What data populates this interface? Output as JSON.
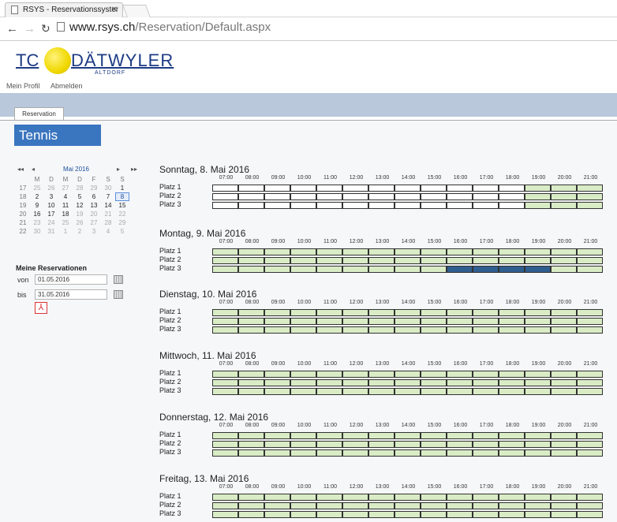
{
  "browser": {
    "tab_title": "RSYS - Reservationssyster",
    "url_host": "www.rsys.ch",
    "url_path": "/Reservation/Default.aspx"
  },
  "logo": {
    "tc": "TC",
    "name": "DÄTWYLER",
    "sub": "ALTDORF"
  },
  "menu": {
    "profile": "Mein Profil",
    "logout": "Abmelden"
  },
  "tab": "Reservation",
  "section_title": "Tennis",
  "calendar": {
    "month": "Mai 2016",
    "nav": {
      "first": "◂◂",
      "prev": "◂",
      "next": "▸",
      "last": "▸▸"
    },
    "weekdays": [
      "M",
      "D",
      "M",
      "D",
      "F",
      "S",
      "S"
    ],
    "weeks": [
      {
        "wk": "17",
        "days": [
          "25",
          "26",
          "27",
          "28",
          "29",
          "30",
          "1"
        ]
      },
      {
        "wk": "18",
        "days": [
          "2",
          "3",
          "4",
          "5",
          "6",
          "7",
          "8"
        ]
      },
      {
        "wk": "19",
        "days": [
          "9",
          "10",
          "11",
          "12",
          "13",
          "14",
          "15"
        ]
      },
      {
        "wk": "20",
        "days": [
          "16",
          "17",
          "18",
          "19",
          "20",
          "21",
          "22"
        ]
      },
      {
        "wk": "21",
        "days": [
          "23",
          "24",
          "25",
          "26",
          "27",
          "28",
          "29"
        ]
      },
      {
        "wk": "22",
        "days": [
          "30",
          "31",
          "1",
          "2",
          "3",
          "4",
          "5"
        ]
      }
    ]
  },
  "my_reservations": {
    "title": "Meine Reservationen",
    "from_label": "von",
    "from_value": "01.05.2016",
    "to_label": "bis",
    "to_value": "31.05.2016",
    "pdf_icon": "pdf-icon"
  },
  "times": [
    "07:00",
    "08:00",
    "09:00",
    "10:00",
    "11:00",
    "12:00",
    "13:00",
    "14:00",
    "15:00",
    "16:00",
    "17:00",
    "18:00",
    "19:00",
    "20:00",
    "21:00"
  ],
  "courts": [
    "Platz 1",
    "Platz 2",
    "Platz 3"
  ],
  "colors": {
    "free": "#d9ecc6",
    "past": "#ffffff",
    "booked": "#2f5e8f",
    "accent": "#3a75bf"
  },
  "days": [
    {
      "title": "Sonntag, 8. Mai 2016",
      "rows": [
        [
          "p",
          "p",
          "p",
          "p",
          "p",
          "p",
          "p",
          "p",
          "p",
          "p",
          "p",
          "p",
          "g",
          "g",
          "g"
        ],
        [
          "p",
          "p",
          "p",
          "p",
          "p",
          "p",
          "p",
          "p",
          "p",
          "p",
          "p",
          "p",
          "g",
          "g",
          "g"
        ],
        [
          "p",
          "p",
          "p",
          "p",
          "p",
          "p",
          "p",
          "p",
          "p",
          "p",
          "p",
          "p",
          "g",
          "g",
          "g"
        ]
      ]
    },
    {
      "title": "Montag, 9. Mai 2016",
      "rows": [
        [
          "g",
          "g",
          "g",
          "g",
          "g",
          "g",
          "g",
          "g",
          "g",
          "g",
          "g",
          "g",
          "g",
          "g",
          "g"
        ],
        [
          "g",
          "g",
          "g",
          "g",
          "g",
          "g",
          "g",
          "g",
          "g",
          "g",
          "g",
          "g",
          "g",
          "g",
          "g"
        ],
        [
          "g",
          "g",
          "g",
          "g",
          "g",
          "g",
          "g",
          "g",
          "g",
          "b",
          "b",
          "b",
          "b",
          "g",
          "g"
        ]
      ]
    },
    {
      "title": "Dienstag, 10. Mai 2016",
      "rows": [
        [
          "g",
          "g",
          "g",
          "g",
          "g",
          "g",
          "g",
          "g",
          "g",
          "g",
          "g",
          "g",
          "g",
          "g",
          "g"
        ],
        [
          "g",
          "g",
          "g",
          "g",
          "g",
          "g",
          "g",
          "g",
          "g",
          "g",
          "g",
          "g",
          "g",
          "g",
          "g"
        ],
        [
          "g",
          "g",
          "g",
          "g",
          "g",
          "g",
          "g",
          "g",
          "g",
          "g",
          "g",
          "g",
          "g",
          "g",
          "g"
        ]
      ]
    },
    {
      "title": "Mittwoch, 11. Mai 2016",
      "rows": [
        [
          "g",
          "g",
          "g",
          "g",
          "g",
          "g",
          "g",
          "g",
          "g",
          "g",
          "g",
          "g",
          "g",
          "g",
          "g"
        ],
        [
          "g",
          "g",
          "g",
          "g",
          "g",
          "g",
          "g",
          "g",
          "g",
          "g",
          "g",
          "g",
          "g",
          "g",
          "g"
        ],
        [
          "g",
          "g",
          "g",
          "g",
          "g",
          "g",
          "g",
          "g",
          "g",
          "g",
          "g",
          "g",
          "g",
          "g",
          "g"
        ]
      ]
    },
    {
      "title": "Donnerstag, 12. Mai 2016",
      "rows": [
        [
          "g",
          "g",
          "g",
          "g",
          "g",
          "g",
          "g",
          "g",
          "g",
          "g",
          "g",
          "g",
          "g",
          "g",
          "g"
        ],
        [
          "g",
          "g",
          "g",
          "g",
          "g",
          "g",
          "g",
          "g",
          "g",
          "g",
          "g",
          "g",
          "g",
          "g",
          "g"
        ],
        [
          "g",
          "g",
          "g",
          "g",
          "g",
          "g",
          "g",
          "g",
          "g",
          "g",
          "g",
          "g",
          "g",
          "g",
          "g"
        ]
      ]
    },
    {
      "title": "Freitag, 13. Mai 2016",
      "rows": [
        [
          "g",
          "g",
          "g",
          "g",
          "g",
          "g",
          "g",
          "g",
          "g",
          "g",
          "g",
          "g",
          "g",
          "g",
          "g"
        ],
        [
          "g",
          "g",
          "g",
          "g",
          "g",
          "g",
          "g",
          "g",
          "g",
          "g",
          "g",
          "g",
          "g",
          "g",
          "g"
        ],
        [
          "g",
          "g",
          "g",
          "g",
          "g",
          "g",
          "g",
          "g",
          "g",
          "g",
          "g",
          "g",
          "g",
          "g",
          "g"
        ]
      ]
    }
  ]
}
